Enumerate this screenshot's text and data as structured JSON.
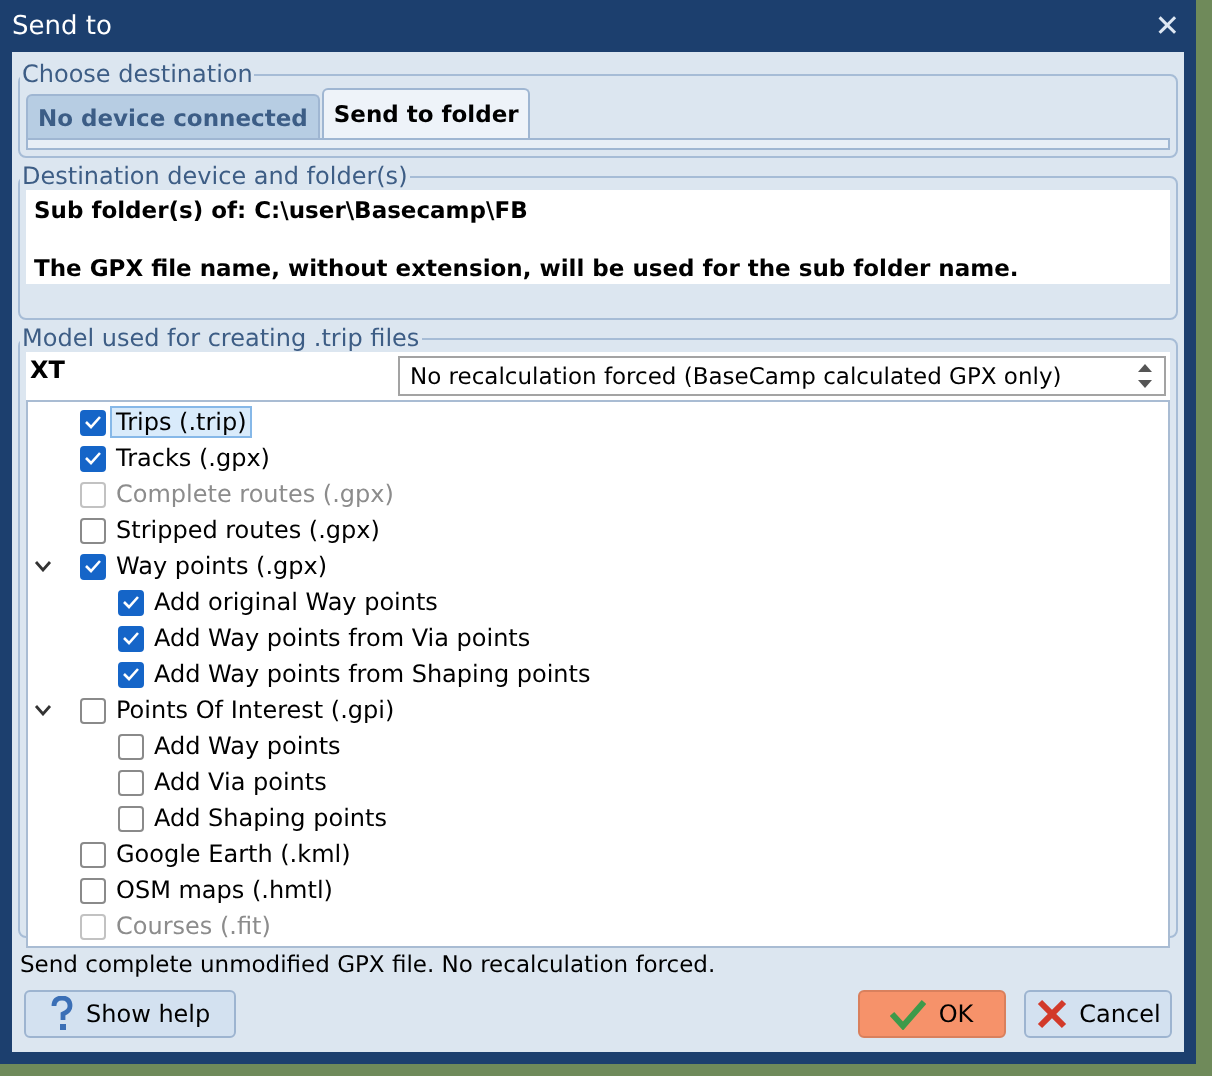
{
  "window": {
    "title": "Send to",
    "close": "✕"
  },
  "destination": {
    "legend": "Choose destination",
    "tabs": [
      {
        "label": "No device connected",
        "selected": false
      },
      {
        "label": "Send to folder",
        "selected": true
      }
    ]
  },
  "folder": {
    "legend": "Destination device and folder(s)",
    "lines": [
      "Sub folder(s) of: C:\\user\\Basecamp\\FB",
      "The GPX file name, without extension, will be used for the sub folder name."
    ]
  },
  "model": {
    "legend": "Model used for creating .trip files",
    "name": "XT",
    "recalculation": "No recalculation forced (BaseCamp calculated GPX only)",
    "tree": [
      {
        "label": "Trips (.trip)",
        "checked": true,
        "disabled": false,
        "selected": true
      },
      {
        "label": "Tracks (.gpx)",
        "checked": true,
        "disabled": false,
        "selected": false
      },
      {
        "label": "Complete routes (.gpx)",
        "checked": false,
        "disabled": true,
        "selected": false
      },
      {
        "label": "Stripped routes (.gpx)",
        "checked": false,
        "disabled": false,
        "selected": false
      },
      {
        "label": "Way points (.gpx)",
        "checked": true,
        "disabled": false,
        "selected": false,
        "expanded": true,
        "children": [
          {
            "label": "Add original Way points",
            "checked": true,
            "disabled": false,
            "selected": false
          },
          {
            "label": "Add Way points from Via points",
            "checked": true,
            "disabled": false,
            "selected": false
          },
          {
            "label": "Add Way points from Shaping points",
            "checked": true,
            "disabled": false,
            "selected": false
          }
        ]
      },
      {
        "label": "Points Of Interest (.gpi)",
        "checked": false,
        "disabled": false,
        "selected": false,
        "expanded": true,
        "children": [
          {
            "label": "Add Way points",
            "checked": false,
            "disabled": false,
            "selected": false
          },
          {
            "label": "Add Via points",
            "checked": false,
            "disabled": false,
            "selected": false
          },
          {
            "label": "Add Shaping points",
            "checked": false,
            "disabled": false,
            "selected": false
          }
        ]
      },
      {
        "label": "Google Earth (.kml)",
        "checked": false,
        "disabled": false,
        "selected": false
      },
      {
        "label": "OSM maps (.hmtl)",
        "checked": false,
        "disabled": false,
        "selected": false
      },
      {
        "label": "Courses (.fit)",
        "checked": false,
        "disabled": true,
        "selected": false
      }
    ]
  },
  "status_bar": "Send complete unmodified GPX file. No recalculation forced.",
  "buttons": [
    {
      "kind": "help",
      "label": "Show help"
    },
    {
      "kind": "ok",
      "label": "OK"
    },
    {
      "kind": "cancel",
      "label": "Cancel"
    }
  ]
}
